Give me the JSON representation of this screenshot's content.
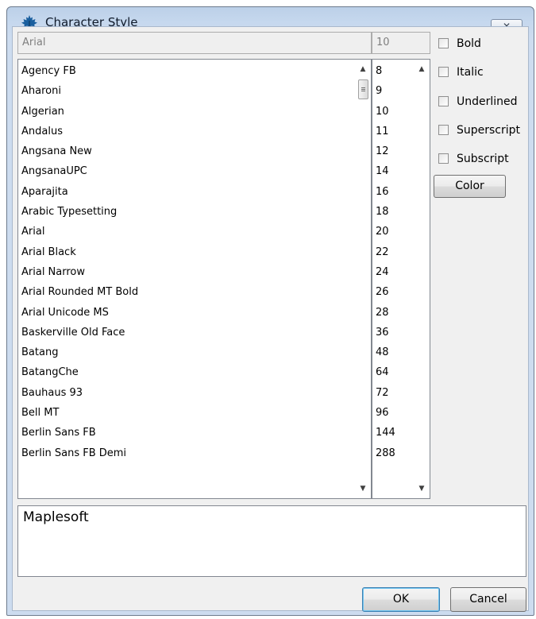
{
  "window": {
    "title": "Character Style",
    "app_icon": "maple-leaf-icon",
    "close_glyph": "✕"
  },
  "font_field": {
    "value": "Arial"
  },
  "size_field": {
    "value": "10"
  },
  "font_list": {
    "items": [
      "Agency FB",
      "Aharoni",
      "Algerian",
      "Andalus",
      "Angsana New",
      "AngsanaUPC",
      "Aparajita",
      "Arabic Typesetting",
      "Arial",
      "Arial Black",
      "Arial Narrow",
      "Arial Rounded MT Bold",
      "Arial Unicode MS",
      "Baskerville Old Face",
      "Batang",
      "BatangChe",
      "Bauhaus 93",
      "Bell MT",
      "Berlin Sans FB",
      "Berlin Sans FB Demi"
    ]
  },
  "size_list": {
    "items": [
      "8",
      "9",
      "10",
      "11",
      "12",
      "14",
      "16",
      "18",
      "20",
      "22",
      "24",
      "26",
      "28",
      "36",
      "48",
      "64",
      "72",
      "96",
      "144",
      "288"
    ]
  },
  "options": {
    "bold": {
      "label": "Bold",
      "checked": false
    },
    "italic": {
      "label": "Italic",
      "checked": false
    },
    "underlined": {
      "label": "Underlined",
      "checked": false
    },
    "superscript": {
      "label": "Superscript",
      "checked": false
    },
    "subscript": {
      "label": "Subscript",
      "checked": false
    }
  },
  "color_button": {
    "label": "Color"
  },
  "preview": {
    "text": "Maplesoft"
  },
  "footer": {
    "ok_label": "OK",
    "cancel_label": "Cancel"
  },
  "colors": {
    "title_bar": "#c6d8ee",
    "accent": "#3c7fb1",
    "icon": "#1a5f9e"
  }
}
